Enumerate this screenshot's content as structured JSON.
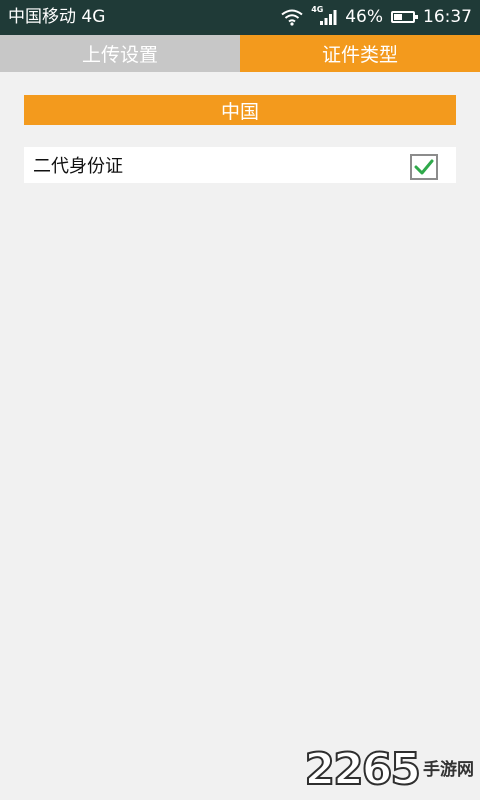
{
  "status_bar": {
    "carrier": "中国移动 4G",
    "signal_tag": "4G",
    "battery_text": "46%",
    "battery_level": 0.46,
    "time": "16:37",
    "icons": [
      "wifi-icon",
      "signal-icon",
      "battery-icon"
    ]
  },
  "tabs": [
    {
      "label": "上传设置",
      "active": false
    },
    {
      "label": "证件类型",
      "active": true
    }
  ],
  "section": {
    "header": "中国",
    "options": [
      {
        "label": "二代身份证",
        "checked": true
      }
    ]
  },
  "watermark": {
    "number": "2265",
    "text": "手游网"
  },
  "colors": {
    "status_bar_bg": "#1f3a37",
    "accent": "#f39a1d",
    "tab_inactive": "#c7c7c7",
    "background": "#f1f1f1",
    "check_green": "#2ea94a"
  }
}
